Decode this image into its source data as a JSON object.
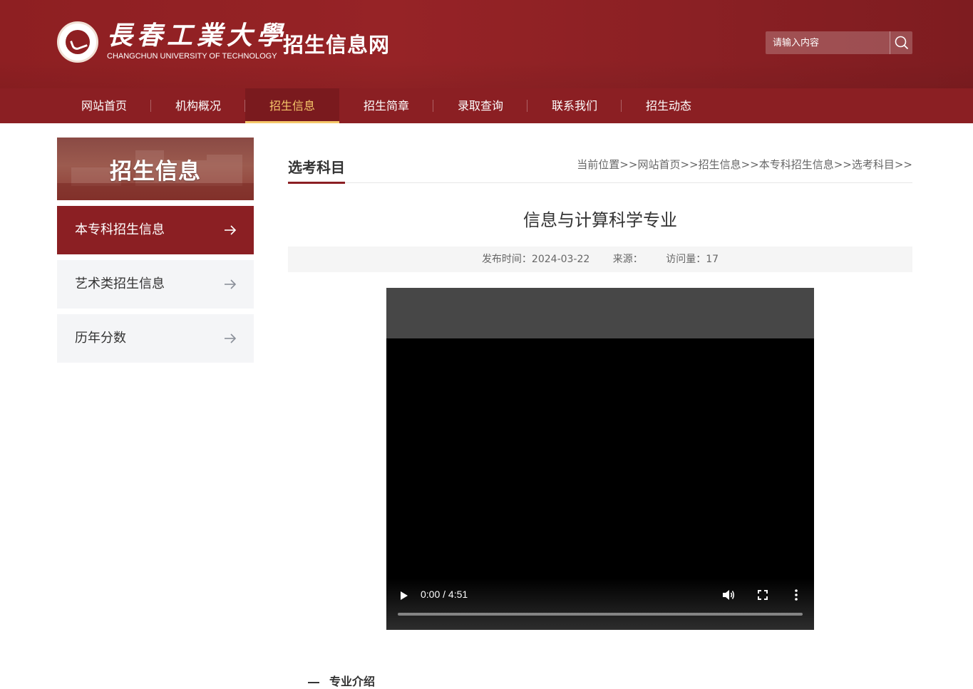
{
  "header": {
    "logo_cn": "長春工業大學",
    "logo_en": "CHANGCHUN UNIVERSITY OF TECHNOLOGY",
    "site_title": "招生信息网",
    "search_placeholder": "请输入内容"
  },
  "nav": {
    "items": [
      {
        "label": "网站首页"
      },
      {
        "label": "机构概况"
      },
      {
        "label": "招生信息"
      },
      {
        "label": "招生简章"
      },
      {
        "label": "录取查询"
      },
      {
        "label": "联系我们"
      },
      {
        "label": "招生动态"
      }
    ],
    "active_index": 2
  },
  "sidebar": {
    "banner_title": "招生信息",
    "items": [
      {
        "label": "本专科招生信息"
      },
      {
        "label": "艺术类招生信息"
      },
      {
        "label": "历年分数"
      }
    ]
  },
  "main": {
    "section_title": "选考科目",
    "breadcrumb": {
      "prefix": "当前位置>>",
      "items": [
        "网站首页>>",
        "招生信息>>",
        "本专科招生信息>>",
        "选考科目>>"
      ]
    },
    "article_title": "信息与计算科学专业",
    "meta": {
      "publish_time": "发布时间：2024-03-22",
      "source": "来源：",
      "views": "访问量：17"
    },
    "video": {
      "time": "0:00 / 4:51",
      "progress": 0
    },
    "intro_heading": "专业介绍"
  },
  "colors": {
    "brand_red": "#8b1f23",
    "nav_active": "#f5c86a",
    "sidebar_bg": "#f4f5f7"
  },
  "icons": {
    "search": "search-icon",
    "arrow": "arrow-right-icon",
    "play": "play-icon",
    "volume": "volume-icon",
    "fullscreen": "fullscreen-icon",
    "more": "more-vert-icon"
  }
}
